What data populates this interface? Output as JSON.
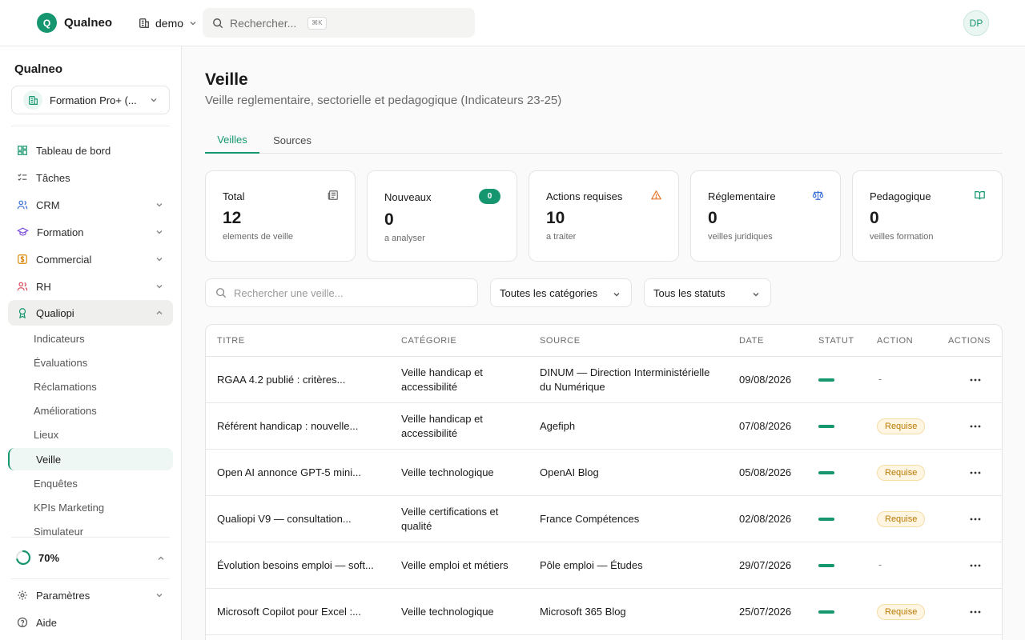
{
  "topbar": {
    "brand_initial": "Q",
    "brand_name": "Qualneo",
    "org_switch_label": "demo",
    "search_placeholder": "Rechercher...",
    "search_shortcut": "⌘K",
    "avatar_initials": "DP"
  },
  "sidebar": {
    "title": "Qualneo",
    "org_selector": "Formation Pro+ (...",
    "nav": [
      {
        "label": "Tableau de bord",
        "icon": "dashboard-grid-icon"
      },
      {
        "label": "Tâches",
        "icon": "checklist-icon"
      },
      {
        "label": "CRM",
        "icon": "users-icon"
      },
      {
        "label": "Formation",
        "icon": "graduation-cap-icon"
      },
      {
        "label": "Commercial",
        "icon": "dollar-icon"
      },
      {
        "label": "RH",
        "icon": "people-icon"
      },
      {
        "label": "Qualiopi",
        "icon": "award-icon"
      }
    ],
    "qualiopi_items": [
      "Indicateurs",
      "Évaluations",
      "Réclamations",
      "Améliorations",
      "Lieux",
      "Veille",
      "Enquêtes",
      "KPIs Marketing",
      "Simulateur"
    ],
    "progress_value": 0.7,
    "progress_label": "70%",
    "settings_label": "Paramètres",
    "help_label": "Aide"
  },
  "main": {
    "title": "Veille",
    "subtitle": "Veille reglementaire, sectorielle et pedagogique (Indicateurs 23-25)",
    "tabs": [
      {
        "label": "Veilles",
        "active": true
      },
      {
        "label": "Sources",
        "active": false
      }
    ],
    "cards": [
      {
        "label": "Total",
        "value": "12",
        "sub": "elements de veille",
        "icon": "newspaper-icon"
      },
      {
        "label": "Nouveaux",
        "value": "0",
        "sub": "a analyser",
        "badge": "0"
      },
      {
        "label": "Actions requises",
        "value": "10",
        "sub": "a traiter",
        "icon": "warning-icon"
      },
      {
        "label": "Réglementaire",
        "value": "0",
        "sub": "veilles juridiques",
        "icon": "scale-icon"
      },
      {
        "label": "Pedagogique",
        "value": "0",
        "sub": "veilles formation",
        "icon": "book-icon"
      }
    ],
    "filters": {
      "search_placeholder": "Rechercher une veille...",
      "category_select": "Toutes les catégories",
      "status_select": "Tous les statuts"
    },
    "table": {
      "columns": [
        "TITRE",
        "CATÉGORIE",
        "SOURCE",
        "DATE",
        "STATUT",
        "ACTION",
        "ACTIONS"
      ],
      "rows": [
        {
          "title": "RGAA 4.2 publié : critères...",
          "category": "Veille handicap et accessibilité",
          "source": "DINUM — Direction Interministérielle du Numérique",
          "date": "09/08/2026",
          "action": "-"
        },
        {
          "title": "Référent handicap : nouvelle...",
          "category": "Veille handicap et accessibilité",
          "source": "Agefiph",
          "date": "07/08/2026",
          "action": "Requise"
        },
        {
          "title": "Open AI annonce GPT-5 mini...",
          "category": "Veille technologique",
          "source": "OpenAI Blog",
          "date": "05/08/2026",
          "action": "Requise"
        },
        {
          "title": "Qualiopi V9 — consultation...",
          "category": "Veille certifications et qualité",
          "source": "France Compétences",
          "date": "02/08/2026",
          "action": "Requise"
        },
        {
          "title": "Évolution besoins emploi — soft...",
          "category": "Veille emploi et métiers",
          "source": "Pôle emploi — Études",
          "date": "29/07/2026",
          "action": "-"
        },
        {
          "title": "Microsoft Copilot pour Excel :...",
          "category": "Veille technologique",
          "source": "Microsoft 365 Blog",
          "date": "25/07/2026",
          "action": "Requise"
        }
      ]
    }
  },
  "colors": {
    "accent": "#16966f",
    "warning": "#e8762b",
    "reglementaire": "#3b6fd8",
    "badge_required_bg": "#fef5e2",
    "badge_required_text": "#b97a00"
  }
}
